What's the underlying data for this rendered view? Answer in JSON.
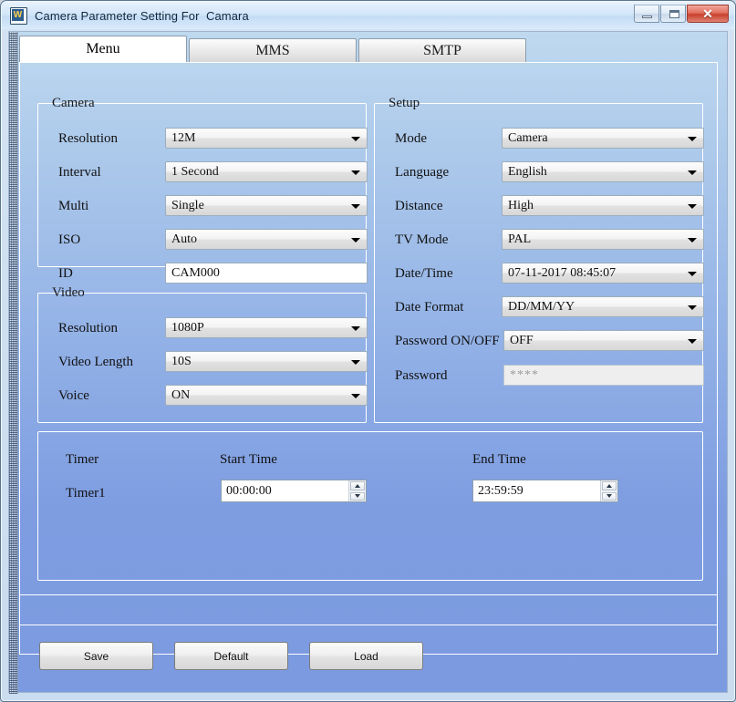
{
  "window": {
    "title": "Camera Parameter Setting For  Camara",
    "icon": "app-icon",
    "icon_glyph": "W",
    "buttons": {
      "minimize": "minimize-icon",
      "maximize": "maximize-icon",
      "close": "✕"
    }
  },
  "tabs": [
    {
      "label": "Menu",
      "active": true
    },
    {
      "label": "MMS",
      "active": false
    },
    {
      "label": "SMTP",
      "active": false
    }
  ],
  "groups": {
    "camera": {
      "legend": "Camera",
      "fields": [
        {
          "label": "Resolution",
          "value": "12M",
          "type": "combo"
        },
        {
          "label": "Interval",
          "value": "1  Second",
          "type": "combo"
        },
        {
          "label": "Multi",
          "value": "Single",
          "type": "combo"
        },
        {
          "label": "ISO",
          "value": "Auto",
          "type": "combo"
        },
        {
          "label": "ID",
          "value": "CAM000",
          "type": "text"
        }
      ]
    },
    "video": {
      "legend": "Video",
      "fields": [
        {
          "label": "Resolution",
          "value": "1080P",
          "type": "combo"
        },
        {
          "label": "Video Length",
          "value": "10S",
          "type": "combo"
        },
        {
          "label": "Voice",
          "value": "ON",
          "type": "combo"
        }
      ]
    },
    "setup": {
      "legend": "Setup",
      "fields": [
        {
          "label": "Mode",
          "value": "Camera",
          "type": "combo"
        },
        {
          "label": "Language",
          "value": "English",
          "type": "combo"
        },
        {
          "label": "Distance",
          "value": "High",
          "type": "combo"
        },
        {
          "label": "TV Mode",
          "value": "PAL",
          "type": "combo"
        },
        {
          "label": "Date/Time",
          "value": "07-11-2017 08:45:07",
          "type": "combo"
        },
        {
          "label": "Date Format",
          "value": "DD/MM/YY",
          "type": "combo"
        },
        {
          "label": "Password ON/OFF",
          "value": "OFF",
          "type": "combo"
        },
        {
          "label": "Password",
          "value": "****",
          "type": "text-disabled"
        }
      ]
    },
    "timer": {
      "label": "Timer",
      "row_label": "Timer1",
      "start_header": "Start Time",
      "end_header": "End Time",
      "start_value": "00:00:00",
      "end_value": "23:59:59"
    }
  },
  "footer": {
    "save": "Save",
    "default": "Default",
    "load": "Load"
  },
  "colors": {
    "titlebar": "#d3e6f9",
    "close_button": "#c8402c",
    "panel_top": "#bfd9ef",
    "panel_bottom": "#7b9ae0",
    "group_border": "#ffffff"
  }
}
